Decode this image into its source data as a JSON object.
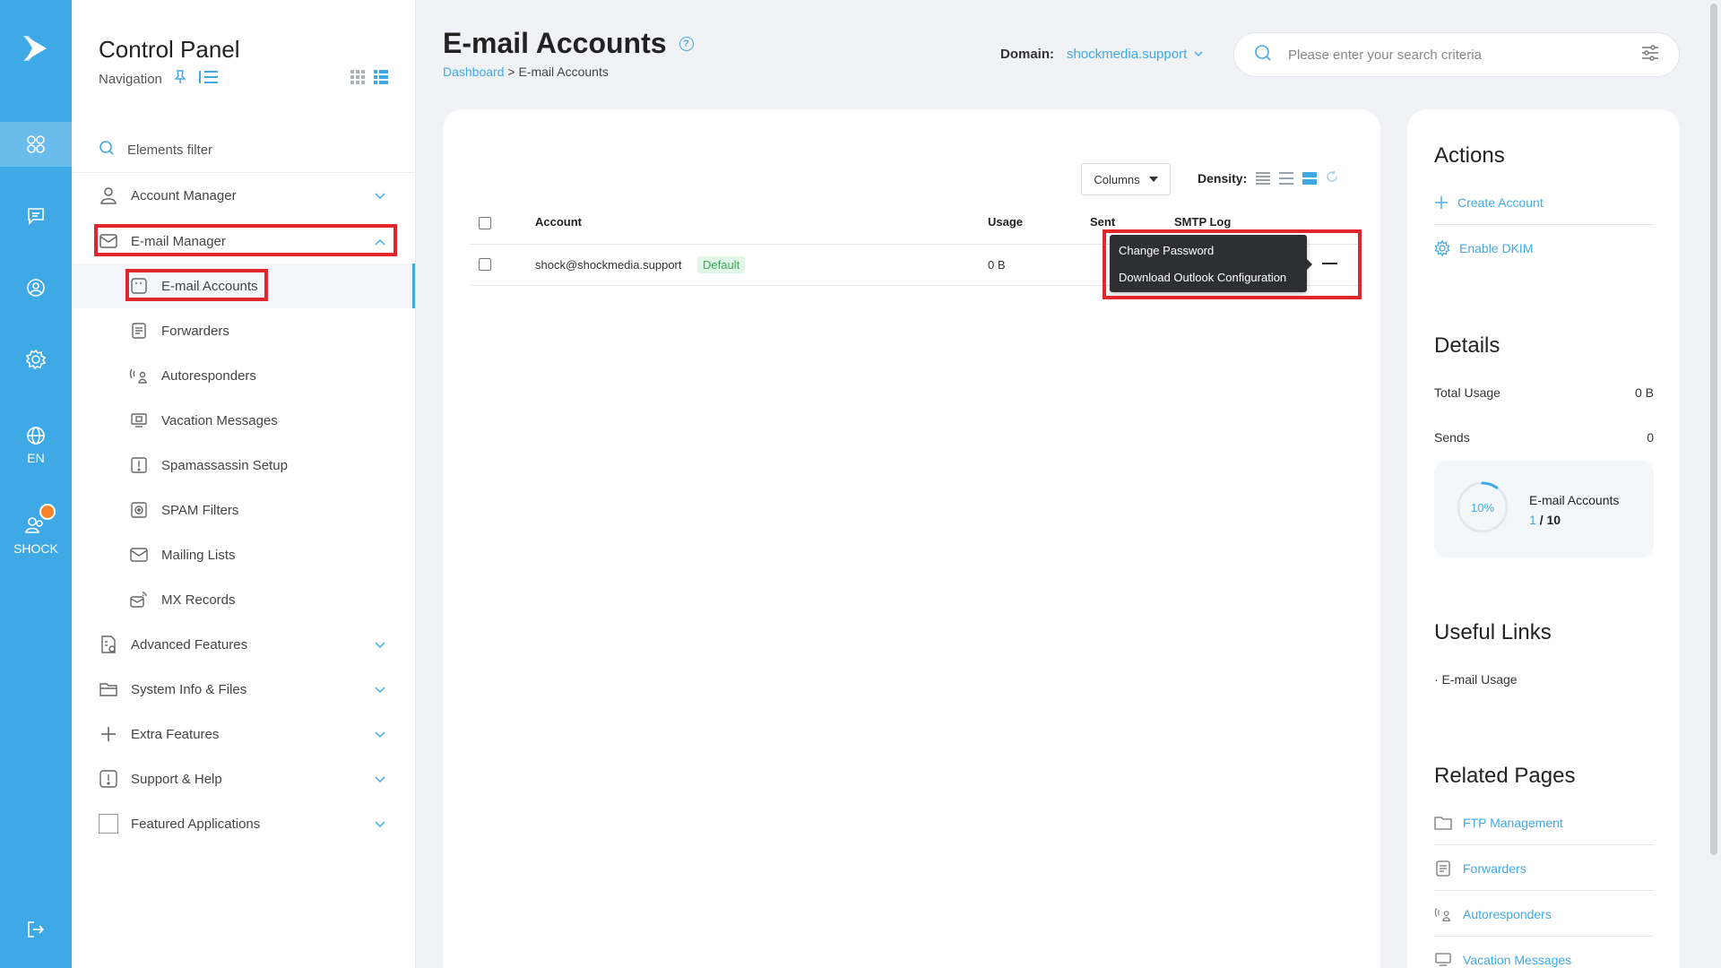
{
  "rail": {
    "items": [
      {
        "name": "dashboard-icon",
        "label": ""
      },
      {
        "name": "messages-icon",
        "label": ""
      },
      {
        "name": "support-icon",
        "label": ""
      },
      {
        "name": "settings-icon",
        "label": ""
      },
      {
        "name": "language-icon",
        "label": "EN"
      },
      {
        "name": "user-icon",
        "label": "SHOCK"
      },
      {
        "name": "logout-icon",
        "label": ""
      }
    ]
  },
  "sidebar": {
    "title": "Control Panel",
    "subtitle": "Navigation",
    "filter_label": "Elements filter",
    "sections": [
      {
        "label": "Account Manager"
      },
      {
        "label": "E-mail Manager"
      },
      {
        "label": "Advanced Features"
      },
      {
        "label": "System Info & Files"
      },
      {
        "label": "Extra Features"
      },
      {
        "label": "Support & Help"
      },
      {
        "label": "Featured Applications"
      }
    ],
    "email_items": [
      {
        "label": "E-mail Accounts"
      },
      {
        "label": "Forwarders"
      },
      {
        "label": "Autoresponders"
      },
      {
        "label": "Vacation Messages"
      },
      {
        "label": "Spamassassin Setup"
      },
      {
        "label": "SPAM Filters"
      },
      {
        "label": "Mailing Lists"
      },
      {
        "label": "MX Records"
      }
    ]
  },
  "header": {
    "title": "E-mail Accounts",
    "breadcrumb_link": "Dashboard",
    "breadcrumb_sep": ">",
    "breadcrumb_current": "E-mail Accounts",
    "domain_label": "Domain:",
    "domain_value": "shockmedia.support",
    "search_placeholder": "Please enter your search criteria"
  },
  "table": {
    "columns_button": "Columns",
    "density_label": "Density:",
    "headers": [
      "Account",
      "Usage",
      "Sent",
      "SMTP Log"
    ],
    "rows": [
      {
        "account": "shock@shockmedia.support",
        "tag": "Default",
        "usage": "0 B"
      }
    ],
    "menu": [
      "Change Password",
      "Download Outlook Configuration"
    ]
  },
  "right": {
    "actions_title": "Actions",
    "actions": [
      "Create Account",
      "Enable DKIM"
    ],
    "details_title": "Details",
    "total_usage_label": "Total Usage",
    "total_usage_value": "0 B",
    "sends_label": "Sends",
    "sends_value": "0",
    "quota_pct_label": "10%",
    "quota_fraction": 0.1,
    "quota_label": "E-mail Accounts",
    "quota_used": "1",
    "quota_sep": "/",
    "quota_total": "10",
    "useful_title": "Useful Links",
    "useful_links": [
      "· E-mail Usage"
    ],
    "related_title": "Related Pages",
    "related": [
      "FTP Management",
      "Forwarders",
      "Autoresponders",
      "Vacation Messages"
    ]
  },
  "colors": {
    "accent": "#3fa9e6",
    "highlight": "#e1262d",
    "rail": "#3fa9e6"
  }
}
